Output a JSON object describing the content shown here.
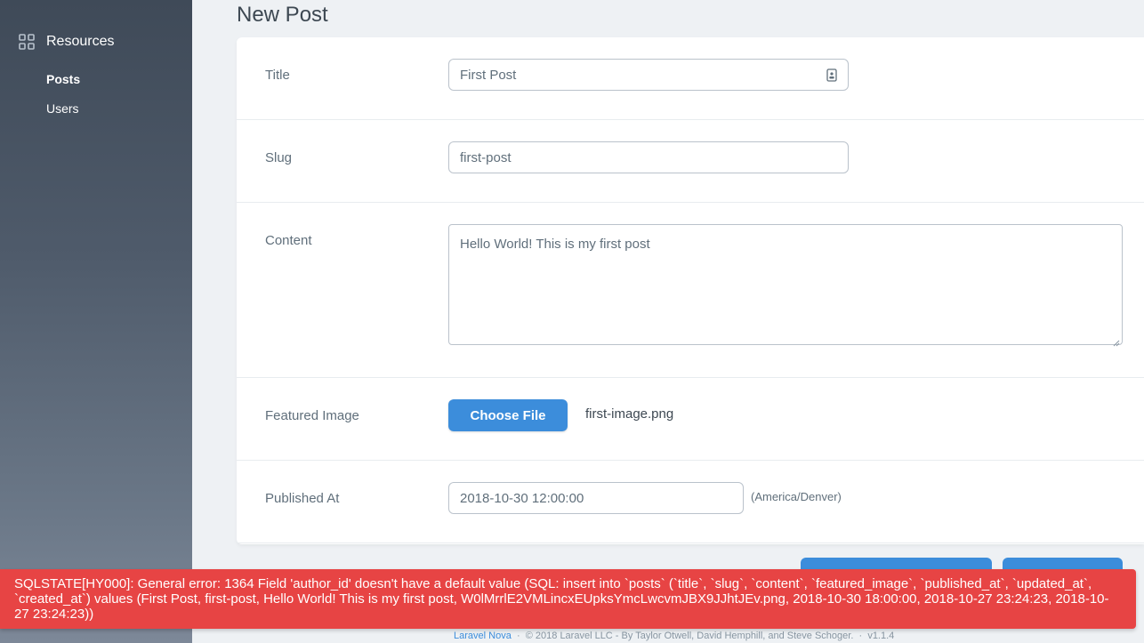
{
  "sidebar": {
    "resources_label": "Resources",
    "items": [
      {
        "label": "Posts",
        "active": true
      },
      {
        "label": "Users",
        "active": false
      }
    ]
  },
  "page": {
    "title": "New Post"
  },
  "form": {
    "title": {
      "label": "Title",
      "value": "First Post"
    },
    "slug": {
      "label": "Slug",
      "value": "first-post"
    },
    "content": {
      "label": "Content",
      "value": "Hello World! This is my first post"
    },
    "featured_image": {
      "label": "Featured Image",
      "button_label": "Choose File",
      "file_name": "first-image.png"
    },
    "published_at": {
      "label": "Published At",
      "value": "2018-10-30 12:00:00",
      "timezone": "(America/Denver)"
    }
  },
  "error": {
    "message": "SQLSTATE[HY000]: General error: 1364 Field 'author_id' doesn't have a default value (SQL: insert into `posts` (`title`, `slug`, `content`, `featured_image`, `published_at`, `updated_at`, `created_at`) values (First Post, first-post, Hello World! This is my first post, W0lMrrlE2VMLincxEUpksYmcLwcvmJBX9JJhtJEv.png, 2018-10-30 18:00:00, 2018-10-27 23:24:23, 2018-10-27 23:24:23))"
  },
  "footer": {
    "link": "Laravel Nova",
    "separator": "·",
    "credits": "© 2018 Laravel LLC - By Taylor Otwell, David Hemphill, and Steve Schoger.",
    "version": "v1.1.4"
  },
  "colors": {
    "accent": "#3c8ddb",
    "error": "#e74444"
  },
  "icons": {
    "resources": "grid-icon",
    "title_field": "contact-card-icon"
  }
}
